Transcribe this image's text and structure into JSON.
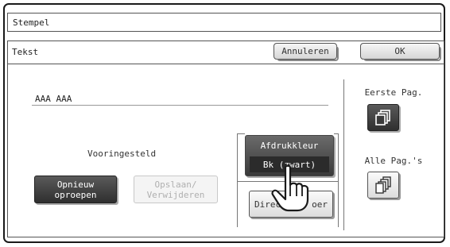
{
  "window": {
    "title": "Stempel"
  },
  "header": {
    "label": "Tekst",
    "cancel_label": "Annuleren",
    "ok_label": "OK"
  },
  "text_field": {
    "value": "AAA AAA"
  },
  "preset": {
    "label": "Vooringesteld",
    "recall_label": "Opnieuw\noproepen",
    "save_delete_label": "Opslaan/\nVerwijderen"
  },
  "print_color": {
    "label": "Afdrukkleur",
    "value": "Bk (zwart)"
  },
  "direct_print": {
    "label_visible": "Direct",
    "label_suffix": "oer"
  },
  "pages": {
    "first_label": "Eerste Pag.",
    "all_label": "Alle Pag.'s"
  },
  "colors": {
    "dark_button": "#3a3a3a",
    "border": "#555555"
  },
  "icons": {
    "first_page": "pages-stack-icon",
    "all_pages": "multi-pages-stack-icon",
    "cursor": "pointing-hand-icon"
  }
}
